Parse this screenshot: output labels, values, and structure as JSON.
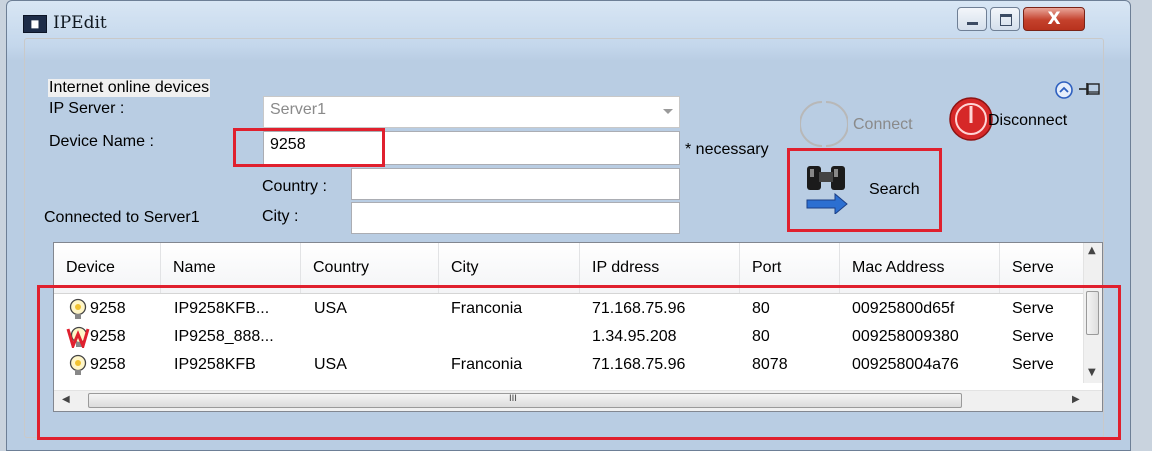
{
  "window": {
    "title": "IPEdit"
  },
  "group": {
    "label": "Internet online devices"
  },
  "form": {
    "ip_server_label": "IP Server :",
    "ip_server_value": "Server1",
    "device_name_label": "Device Name :",
    "device_name_value": "9258",
    "necessary_note": "* necessary",
    "country_label": "Country :",
    "country_value": "",
    "city_label": "City :",
    "city_value": "",
    "connected_status": "Connected to Server1"
  },
  "buttons": {
    "connect": "Connect",
    "disconnect": "Disconnect",
    "search": "Search"
  },
  "table": {
    "columns": [
      "Device",
      "Name",
      "Country",
      "City",
      "IP ddress",
      "Port",
      "Mac Address",
      "Serve"
    ],
    "rows": [
      {
        "status_icon": "bulb-icon",
        "device": "9258",
        "name": "IP9258KFB...",
        "country": "USA",
        "city": "Franconia",
        "ip": "71.168.75.96",
        "port": "80",
        "mac": "00925800d65f",
        "server": "Serve"
      },
      {
        "status_icon": "warning-bulb-icon",
        "device": "9258",
        "name": "IP9258_888...",
        "country": "",
        "city": "",
        "ip": "1.34.95.208",
        "port": "80",
        "mac": "009258009380",
        "server": "Serve"
      },
      {
        "status_icon": "bulb-icon",
        "device": "9258",
        "name": "IP9258KFB",
        "country": "USA",
        "city": "Franconia",
        "ip": "71.168.75.96",
        "port": "8078",
        "mac": "009258004a76",
        "server": "Serve"
      }
    ],
    "scroll_grip": "III"
  },
  "colors": {
    "highlight": "#e0202e",
    "close_button": "#c4412c",
    "disconnect": "#d62828"
  }
}
